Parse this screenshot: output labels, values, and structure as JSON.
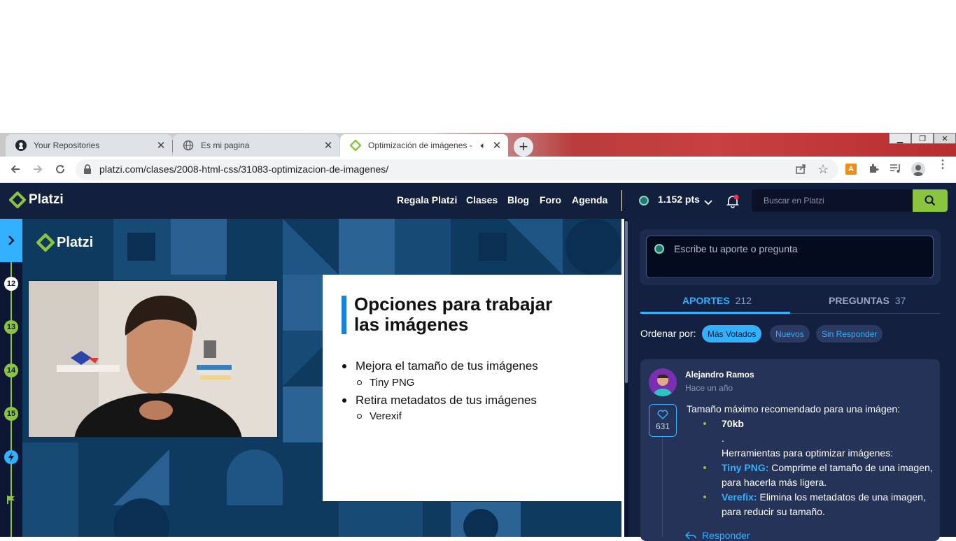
{
  "browser": {
    "tabs": [
      {
        "title": "Your Repositories",
        "icon": "github-icon"
      },
      {
        "title": "Es mi pagina",
        "icon": "globe-icon"
      },
      {
        "title": "Optimización de imágenes -",
        "icon": "platzi-icon",
        "audio": "speaker-icon"
      }
    ],
    "new_tab": "+",
    "url": "platzi.com/clases/2008-html-css/31083-optimizacion-de-imagenes/",
    "extension_badge": "A"
  },
  "header": {
    "brand": "Platzi",
    "nav": [
      "Regala Platzi",
      "Clases",
      "Blog",
      "Foro",
      "Agenda"
    ],
    "points": "1.152 pts",
    "search_placeholder": "Buscar en Platzi",
    "accent": "#8bc43f"
  },
  "timeline": {
    "steps": [
      "12",
      "13",
      "14",
      "15"
    ]
  },
  "video": {
    "brand": "Platzi",
    "slide": {
      "title_line1": "Opciones para trabajar",
      "title_line2": "las imágenes",
      "items": [
        {
          "text": "Mejora el tamaño de tus imágenes",
          "sub": "Tiny PNG"
        },
        {
          "text": "Retira metadatos de tus imágenes",
          "sub": "Verexif"
        }
      ]
    }
  },
  "panel": {
    "composer_placeholder": "Escribe tu aporte o pregunta",
    "tabs": [
      {
        "label": "APORTES",
        "count": "212",
        "active": true
      },
      {
        "label": "PREGUNTAS",
        "count": "37",
        "active": false
      }
    ],
    "sort_label": "Ordenar por:",
    "sort_options": [
      "Más Votados",
      "Nuevos",
      "Sin Responder"
    ],
    "comment": {
      "author": "Alejandro Ramos",
      "time": "Hace un año",
      "likes": "631",
      "line1": "Tamaño máximo recomendado para una imágen:",
      "bullet1": "70kb",
      "dot": ".",
      "tools_heading": "Herramientas para optimizar imágenes:",
      "tool1_name": "Tiny PNG:",
      "tool1_desc_a": " Comprime el tamaño de una imagen,",
      "tool1_desc_b": "para hacerla más ligera.",
      "tool2_name": "Verefix:",
      "tool2_desc_a": " Elimina los metadatos de una imagen,",
      "tool2_desc_b": "para reducir su tamaño.",
      "reply": "Responder"
    }
  }
}
